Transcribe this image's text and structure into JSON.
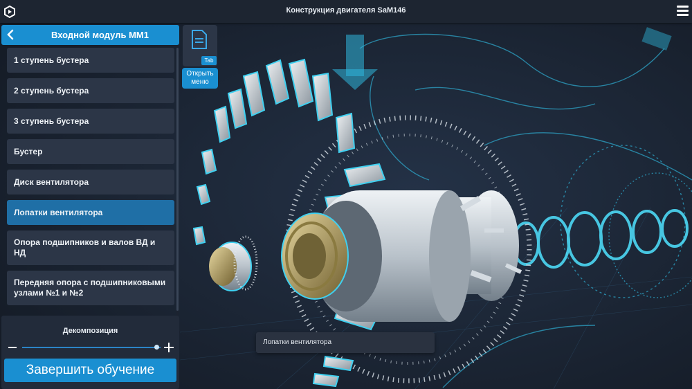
{
  "app": {
    "title": "Конструкция двигателя SaM146"
  },
  "sidebar": {
    "title": "Входной модуль MM1",
    "items": [
      {
        "label": "1 ступень бустера",
        "active": false
      },
      {
        "label": "2 ступень бустера",
        "active": false
      },
      {
        "label": "3 ступень бустера",
        "active": false
      },
      {
        "label": "Бустер",
        "active": false
      },
      {
        "label": "Диск вентилятора",
        "active": false
      },
      {
        "label": "Лопатки вентилятора",
        "active": true
      },
      {
        "label": "Опора подшипников и валов ВД и НД",
        "active": false
      },
      {
        "label": "Передняя опора с подшипниковыми узлами №1 и №2",
        "active": false
      }
    ]
  },
  "decomposition": {
    "label": "Декомпозиция",
    "value": 0.97
  },
  "finish_button": {
    "label": "Завершить обучение"
  },
  "document_button": {
    "hotkey": "Tab",
    "label": "Открыть меню"
  },
  "viewport": {
    "tooltip": "Лопатки вентилятора"
  },
  "colors": {
    "accent": "#1a8fd1",
    "active_item": "#1f6fa6",
    "hologram": "#29c6e8",
    "background": "#1a2230"
  },
  "icons": [
    "logo-icon",
    "hamburger-menu-icon",
    "back-arrow-icon",
    "document-icon",
    "minus-icon",
    "plus-icon"
  ]
}
